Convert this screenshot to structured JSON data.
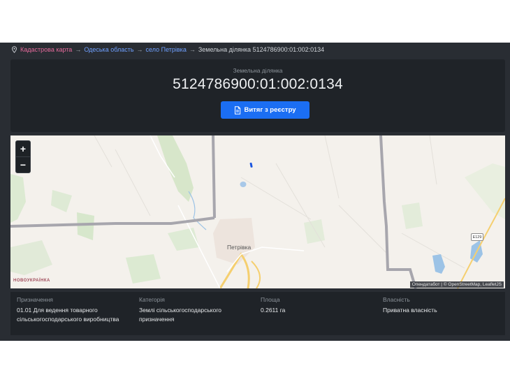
{
  "breadcrumb": {
    "items": [
      "Кадастрова карта",
      "Одеська область",
      "село Петрівка"
    ],
    "separator": "→",
    "current": "Земельна ділянка 5124786900:01:002:0134"
  },
  "parcel": {
    "subtitle": "Земельна ділянка",
    "number": "5124786900:01:002:0134",
    "extract_button": "Витяг з реєстру"
  },
  "map": {
    "zoom_in": "+",
    "zoom_out": "−",
    "town_label": "Петрівка",
    "region_label": "НОВОУКРАЇНКА",
    "road_shield": "Е129",
    "attribution": "Опендатабот | © OpenStreetMap, LeafletJS"
  },
  "details": {
    "purpose_label": "Призначення",
    "purpose_value": "01.01 Для ведення товарного сільськогосподарського виробництва",
    "category_label": "Категорія",
    "category_value": "Землі сільськогосподарського призначення",
    "area_label": "Площа",
    "area_value": "0.2611 га",
    "ownership_label": "Власність",
    "ownership_value": "Приватна власність"
  },
  "colors": {
    "accent": "#1b6ef3",
    "breadcrumb_root": "#e46a9b",
    "breadcrumb_link": "#6fa0ff",
    "panel_bg": "#1f2328"
  }
}
